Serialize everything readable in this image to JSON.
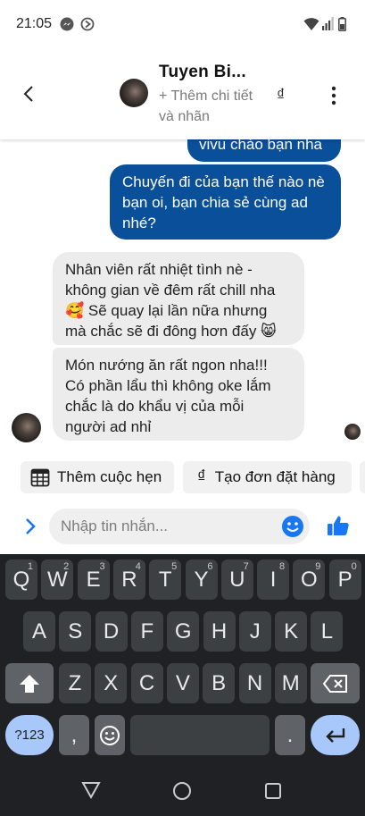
{
  "status_bar": {
    "time": "21:05"
  },
  "header": {
    "contact_name": "Tuyen Bi...",
    "add_details": "+ Thêm chi tiết và nhãn",
    "currency_symbol": "₫"
  },
  "messages": [
    {
      "direction": "out",
      "text": "vivu chào bạn nha"
    },
    {
      "direction": "out",
      "text": "Chuyến đi của bạn thế nào nè bạn oi, bạn chia sẻ cùng ad nhé?"
    },
    {
      "direction": "in",
      "line1": "Nhân viên rất nhiệt tình nè -",
      "line2": "không gian về đêm rất chill nha",
      "line3": "🥰 Sẽ quay lại lần nữa nhưng",
      "line4": "mà chắc sẽ đi đông hơn đấy 😸"
    },
    {
      "direction": "in",
      "line1": "Món nướng ăn rất ngon nha!!!",
      "line2": "Có phần lẩu thì không oke lắm",
      "line3": "chắc là do khẩu vị của mỗi",
      "line4": "người ad nhỉ"
    }
  ],
  "quick_actions": [
    {
      "label": "Thêm cuộc hẹn",
      "icon": "calendar-icon"
    },
    {
      "label": "Tạo đơn đặt hàng",
      "icon": "dong-icon",
      "icon_glyph": "₫"
    }
  ],
  "composer": {
    "placeholder": "Nhập tin nhắn..."
  },
  "keyboard": {
    "row1": [
      {
        "k": "Q",
        "n": "1"
      },
      {
        "k": "W",
        "n": "2"
      },
      {
        "k": "E",
        "n": "3"
      },
      {
        "k": "R",
        "n": "4"
      },
      {
        "k": "T",
        "n": "5"
      },
      {
        "k": "Y",
        "n": "6"
      },
      {
        "k": "U",
        "n": "7"
      },
      {
        "k": "I",
        "n": "8"
      },
      {
        "k": "O",
        "n": "9"
      },
      {
        "k": "P",
        "n": "0"
      }
    ],
    "row2": [
      "A",
      "S",
      "D",
      "F",
      "G",
      "H",
      "J",
      "K",
      "L"
    ],
    "row3": [
      "Z",
      "X",
      "C",
      "V",
      "B",
      "N",
      "M"
    ],
    "symbols_key": "?123",
    "comma_key": ",",
    "period_key": "."
  },
  "colors": {
    "accent": "#0a4f99",
    "messenger_blue": "#1877f2",
    "incoming_bubble": "#ececec",
    "keyboard_bg": "#202124",
    "enter_key": "#a8c7fa"
  }
}
